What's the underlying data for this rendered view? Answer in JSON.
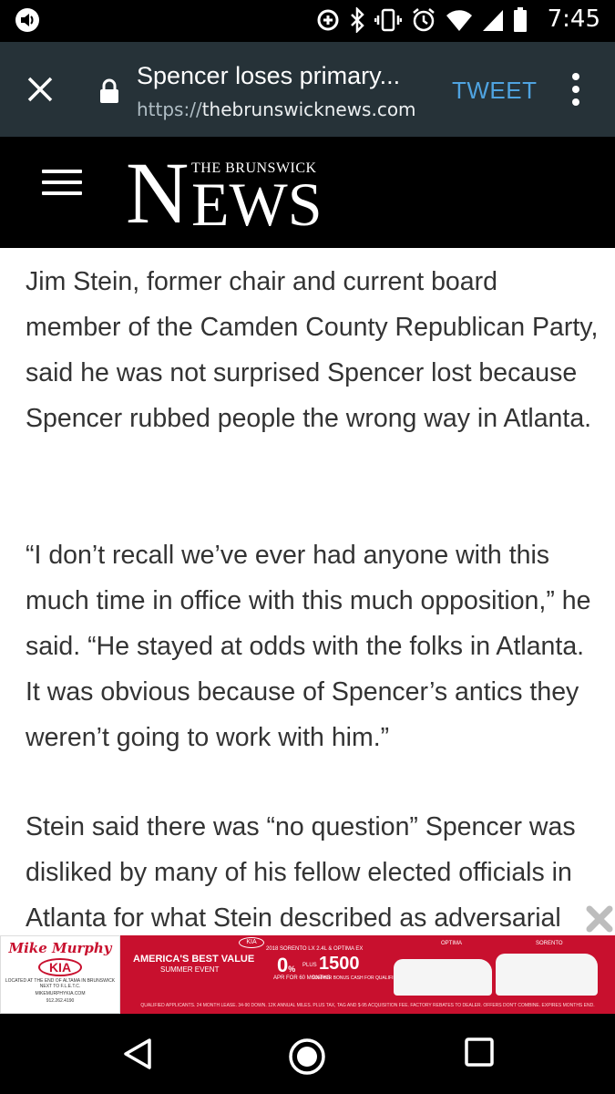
{
  "status_bar": {
    "time": "7:45",
    "icons": [
      "volume-icon",
      "data-saver-icon",
      "bluetooth-icon",
      "vibrate-icon",
      "alarm-icon",
      "wifi-icon",
      "signal-icon",
      "battery-icon"
    ]
  },
  "custom_tab": {
    "title": "Spencer loses primary...",
    "url_scheme": "https://",
    "url_host": "thebrunswicknews.com",
    "action_label": "TWEET",
    "action_color": "#4fa3e0",
    "background_color": "#263238"
  },
  "site_header": {
    "logo_small": "THE BRUNSWICK",
    "logo_n": "N",
    "logo_rest": "EWS"
  },
  "article": {
    "paragraphs": [
      "Jim Stein, former chair and current board member of the Camden County Republican Party, said he was not surprised Spencer lost because Spencer rubbed people the wrong way in Atlanta.",
      "“I don’t recall we’ve ever had anyone with this much time in office with this much opposition,” he said. “He stayed at odds with the folks in Atlanta. It was obvious because of Spencer’s antics they weren’t going to work with him.”",
      "Stein said there was “no question” Spencer was disliked by many of his fellow elected officials in Atlanta for what Stein described as adversarial"
    ]
  },
  "ad": {
    "dealer_name": "Mike Murphy",
    "dealer_brand": "KIA",
    "dealer_location": "LOCATED AT THE END OF ALTAMA IN BRUNSWICK NEXT TO F.L.E.T.C.",
    "dealer_site": "MIKEMURPHYKIA.COM",
    "dealer_phone": "912.262.4190",
    "headline": "AMERICA'S BEST VALUE",
    "subhead": "SUMMER EVENT",
    "offer_title": "2018 SORENTO LX 2.4L & OPTIMA EX",
    "apr_value": "0",
    "apr_unit": "%",
    "apr_label": "APR FOR 60 MONTHS",
    "plus_label": "PLUS",
    "cash_value": "1500",
    "cash_label": "SUMMER BONUS CASH FOR QUALIFIED BUYERS",
    "model_1": "OPTIMA",
    "model_2": "SORENTO",
    "fine_print": "QUALIFIED APPLICANTS. 24 MONTH LEASE. 34-90 DOWN. 12K ANNUAL MILES. PLUS TAX, TAG AND $-95 ACQUISITION FEE. FACTORY REBATES TO DEALER. OFFERS DON'T COMBINE. EXPIRES MONTHS END.",
    "brand_color": "#c8102e"
  }
}
